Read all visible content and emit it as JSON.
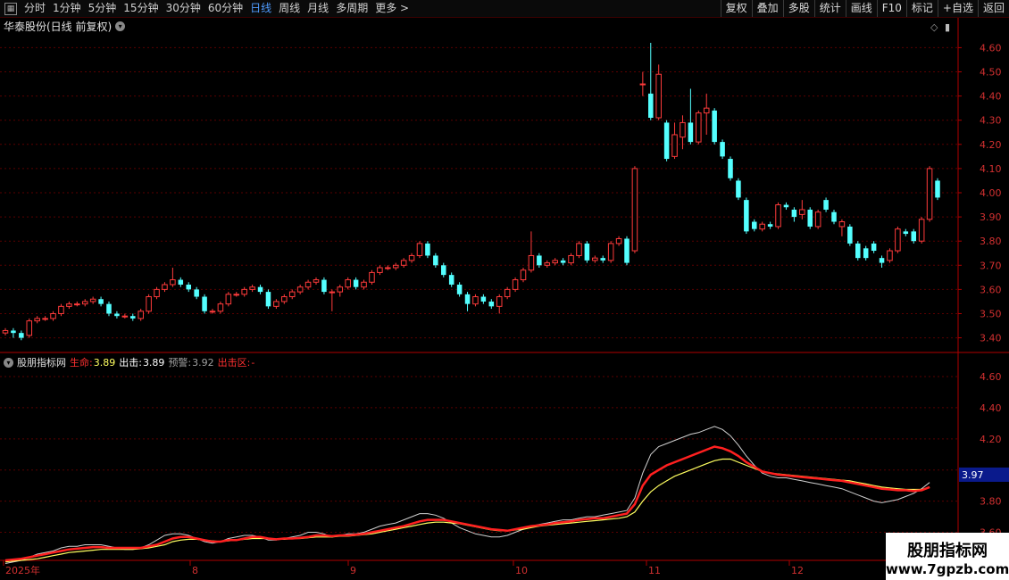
{
  "toolbar": {
    "periods": [
      "分时",
      "1分钟",
      "5分钟",
      "15分钟",
      "30分钟",
      "60分钟",
      "日线",
      "周线",
      "月线",
      "多周期",
      "更多 >"
    ],
    "active_period": "日线",
    "buttons": [
      "复权",
      "叠加",
      "多股",
      "统计",
      "画线",
      "F10",
      "标记",
      "+自选",
      "返回"
    ]
  },
  "stock_title": "华泰股份(日线 前复权)",
  "indicator": {
    "name": "股朋指标网",
    "life_label": "生命:",
    "life_value": "3.89",
    "out_label": "出击:",
    "out_value": "3.89",
    "warn_label": "预警:",
    "warn_value": "3.92",
    "zone_label": "出击区:",
    "zone_value": "-",
    "current_value": "3.97"
  },
  "price_axis": [
    "4.60",
    "4.50",
    "4.40",
    "4.30",
    "4.20",
    "4.10",
    "4.00",
    "3.90",
    "3.80",
    "3.70",
    "3.60",
    "3.50",
    "3.40"
  ],
  "indicator_axis": [
    "4.60",
    "4.40",
    "4.20",
    "3.80",
    "3.60"
  ],
  "date_axis": [
    "2025年",
    "8",
    "9",
    "10",
    "11",
    "12"
  ],
  "watermark": {
    "line1": "股朋指标网",
    "line2": "www.7gpzb.com"
  },
  "colors": {
    "up": "#ff3b3b",
    "down": "#54ffff",
    "grid": "#5a0000",
    "axis": "#b00000",
    "life": "#ff2020",
    "out": "#ffff60",
    "warn": "#d0d0d0"
  },
  "chart_data": {
    "type": "candlestick",
    "ylim": [
      3.36,
      4.66
    ],
    "candles": [
      [
        3.42,
        3.43,
        3.41,
        3.44
      ],
      [
        3.43,
        3.42,
        3.4,
        3.44
      ],
      [
        3.42,
        3.4,
        3.39,
        3.43
      ],
      [
        3.41,
        3.47,
        3.4,
        3.48
      ],
      [
        3.47,
        3.48,
        3.46,
        3.49
      ],
      [
        3.48,
        3.48,
        3.47,
        3.49
      ],
      [
        3.48,
        3.5,
        3.47,
        3.51
      ],
      [
        3.5,
        3.53,
        3.49,
        3.54
      ],
      [
        3.53,
        3.54,
        3.52,
        3.55
      ],
      [
        3.54,
        3.54,
        3.53,
        3.55
      ],
      [
        3.54,
        3.55,
        3.53,
        3.56
      ],
      [
        3.55,
        3.56,
        3.54,
        3.57
      ],
      [
        3.56,
        3.54,
        3.53,
        3.57
      ],
      [
        3.54,
        3.5,
        3.49,
        3.55
      ],
      [
        3.5,
        3.49,
        3.48,
        3.51
      ],
      [
        3.49,
        3.49,
        3.48,
        3.5
      ],
      [
        3.49,
        3.48,
        3.47,
        3.5
      ],
      [
        3.48,
        3.51,
        3.47,
        3.52
      ],
      [
        3.51,
        3.57,
        3.5,
        3.58
      ],
      [
        3.57,
        3.6,
        3.56,
        3.61
      ],
      [
        3.6,
        3.62,
        3.59,
        3.63
      ],
      [
        3.62,
        3.64,
        3.61,
        3.69
      ],
      [
        3.64,
        3.62,
        3.61,
        3.65
      ],
      [
        3.62,
        3.6,
        3.59,
        3.63
      ],
      [
        3.6,
        3.57,
        3.56,
        3.61
      ],
      [
        3.57,
        3.51,
        3.5,
        3.58
      ],
      [
        3.51,
        3.51,
        3.5,
        3.52
      ],
      [
        3.51,
        3.54,
        3.5,
        3.55
      ],
      [
        3.54,
        3.58,
        3.53,
        3.59
      ],
      [
        3.58,
        3.58,
        3.57,
        3.59
      ],
      [
        3.58,
        3.6,
        3.57,
        3.61
      ],
      [
        3.6,
        3.61,
        3.59,
        3.62
      ],
      [
        3.61,
        3.59,
        3.58,
        3.62
      ],
      [
        3.59,
        3.53,
        3.52,
        3.6
      ],
      [
        3.53,
        3.55,
        3.52,
        3.56
      ],
      [
        3.55,
        3.57,
        3.54,
        3.58
      ],
      [
        3.57,
        3.59,
        3.56,
        3.6
      ],
      [
        3.59,
        3.61,
        3.58,
        3.62
      ],
      [
        3.61,
        3.63,
        3.6,
        3.64
      ],
      [
        3.63,
        3.64,
        3.62,
        3.65
      ],
      [
        3.64,
        3.59,
        3.58,
        3.65
      ],
      [
        3.59,
        3.59,
        3.51,
        3.6
      ],
      [
        3.59,
        3.61,
        3.57,
        3.62
      ],
      [
        3.61,
        3.64,
        3.6,
        3.65
      ],
      [
        3.64,
        3.61,
        3.6,
        3.65
      ],
      [
        3.61,
        3.63,
        3.6,
        3.64
      ],
      [
        3.63,
        3.67,
        3.62,
        3.68
      ],
      [
        3.67,
        3.69,
        3.66,
        3.7
      ],
      [
        3.69,
        3.69,
        3.68,
        3.7
      ],
      [
        3.69,
        3.7,
        3.68,
        3.71
      ],
      [
        3.7,
        3.72,
        3.69,
        3.73
      ],
      [
        3.72,
        3.74,
        3.71,
        3.75
      ],
      [
        3.74,
        3.79,
        3.73,
        3.8
      ],
      [
        3.79,
        3.74,
        3.73,
        3.8
      ],
      [
        3.74,
        3.7,
        3.69,
        3.75
      ],
      [
        3.7,
        3.66,
        3.65,
        3.71
      ],
      [
        3.66,
        3.62,
        3.61,
        3.67
      ],
      [
        3.62,
        3.58,
        3.57,
        3.63
      ],
      [
        3.58,
        3.54,
        3.51,
        3.59
      ],
      [
        3.54,
        3.57,
        3.53,
        3.58
      ],
      [
        3.57,
        3.55,
        3.54,
        3.58
      ],
      [
        3.55,
        3.53,
        3.52,
        3.56
      ],
      [
        3.53,
        3.57,
        3.5,
        3.58
      ],
      [
        3.57,
        3.6,
        3.56,
        3.61
      ],
      [
        3.6,
        3.64,
        3.59,
        3.65
      ],
      [
        3.64,
        3.68,
        3.63,
        3.69
      ],
      [
        3.68,
        3.74,
        3.67,
        3.84
      ],
      [
        3.74,
        3.7,
        3.69,
        3.75
      ],
      [
        3.7,
        3.71,
        3.69,
        3.72
      ],
      [
        3.71,
        3.72,
        3.7,
        3.73
      ],
      [
        3.72,
        3.71,
        3.7,
        3.73
      ],
      [
        3.71,
        3.74,
        3.7,
        3.75
      ],
      [
        3.74,
        3.79,
        3.73,
        3.8
      ],
      [
        3.79,
        3.72,
        3.71,
        3.8
      ],
      [
        3.72,
        3.73,
        3.71,
        3.74
      ],
      [
        3.73,
        3.72,
        3.71,
        3.74
      ],
      [
        3.72,
        3.79,
        3.71,
        3.8
      ],
      [
        3.79,
        3.81,
        3.78,
        3.82
      ],
      [
        3.81,
        3.71,
        3.7,
        3.82
      ],
      [
        3.76,
        4.1,
        3.75,
        4.11
      ],
      [
        4.45,
        4.45,
        4.4,
        4.5
      ],
      [
        4.41,
        4.31,
        4.3,
        4.62
      ],
      [
        4.31,
        4.49,
        4.3,
        4.53
      ],
      [
        4.29,
        4.14,
        4.13,
        4.3
      ],
      [
        4.15,
        4.24,
        4.14,
        4.29
      ],
      [
        4.23,
        4.29,
        4.18,
        4.32
      ],
      [
        4.29,
        4.21,
        4.2,
        4.43
      ],
      [
        4.21,
        4.33,
        4.2,
        4.34
      ],
      [
        4.33,
        4.35,
        4.24,
        4.41
      ],
      [
        4.34,
        4.21,
        4.2,
        4.35
      ],
      [
        4.21,
        4.15,
        4.14,
        4.22
      ],
      [
        4.14,
        4.06,
        4.05,
        4.15
      ],
      [
        4.05,
        3.98,
        3.97,
        4.06
      ],
      [
        3.97,
        3.84,
        3.83,
        3.98
      ],
      [
        3.88,
        3.85,
        3.84,
        3.89
      ],
      [
        3.85,
        3.87,
        3.84,
        3.88
      ],
      [
        3.87,
        3.86,
        3.85,
        3.88
      ],
      [
        3.86,
        3.95,
        3.85,
        3.96
      ],
      [
        3.95,
        3.94,
        3.93,
        3.96
      ],
      [
        3.93,
        3.9,
        3.88,
        3.94
      ],
      [
        3.91,
        3.93,
        3.89,
        3.97
      ],
      [
        3.93,
        3.86,
        3.85,
        3.94
      ],
      [
        3.86,
        3.92,
        3.85,
        3.93
      ],
      [
        3.97,
        3.93,
        3.92,
        3.98
      ],
      [
        3.92,
        3.88,
        3.87,
        3.93
      ],
      [
        3.86,
        3.88,
        3.82,
        3.89
      ],
      [
        3.86,
        3.79,
        3.78,
        3.87
      ],
      [
        3.79,
        3.73,
        3.72,
        3.8
      ],
      [
        3.77,
        3.73,
        3.72,
        3.78
      ],
      [
        3.79,
        3.76,
        3.75,
        3.8
      ],
      [
        3.73,
        3.71,
        3.69,
        3.74
      ],
      [
        3.72,
        3.76,
        3.71,
        3.77
      ],
      [
        3.76,
        3.85,
        3.75,
        3.86
      ],
      [
        3.84,
        3.83,
        3.82,
        3.85
      ],
      [
        3.84,
        3.8,
        3.79,
        3.85
      ],
      [
        3.8,
        3.89,
        3.79,
        3.9
      ],
      [
        3.89,
        4.1,
        3.88,
        4.11
      ],
      [
        4.05,
        3.98,
        3.97,
        4.06
      ]
    ],
    "life": [
      3.42,
      3.425,
      3.43,
      3.44,
      3.45,
      3.46,
      3.47,
      3.48,
      3.49,
      3.495,
      3.5,
      3.505,
      3.505,
      3.5,
      3.5,
      3.5,
      3.5,
      3.5,
      3.51,
      3.52,
      3.54,
      3.56,
      3.57,
      3.57,
      3.56,
      3.55,
      3.54,
      3.54,
      3.55,
      3.55,
      3.56,
      3.57,
      3.57,
      3.56,
      3.555,
      3.56,
      3.56,
      3.565,
      3.57,
      3.58,
      3.58,
      3.575,
      3.58,
      3.58,
      3.585,
      3.59,
      3.6,
      3.61,
      3.62,
      3.63,
      3.64,
      3.655,
      3.67,
      3.68,
      3.68,
      3.68,
      3.67,
      3.66,
      3.65,
      3.64,
      3.63,
      3.62,
      3.615,
      3.61,
      3.62,
      3.63,
      3.64,
      3.645,
      3.65,
      3.66,
      3.665,
      3.67,
      3.68,
      3.685,
      3.69,
      3.69,
      3.7,
      3.71,
      3.72,
      3.78,
      3.9,
      3.97,
      4.0,
      4.03,
      4.05,
      4.07,
      4.09,
      4.11,
      4.13,
      4.15,
      4.14,
      4.12,
      4.09,
      4.05,
      4.02,
      3.99,
      3.98,
      3.97,
      3.965,
      3.96,
      3.955,
      3.95,
      3.945,
      3.94,
      3.935,
      3.93,
      3.92,
      3.91,
      3.9,
      3.89,
      3.88,
      3.875,
      3.87,
      3.87,
      3.865,
      3.87,
      3.89
    ],
    "out": [
      3.41,
      3.415,
      3.42,
      3.425,
      3.43,
      3.44,
      3.45,
      3.46,
      3.47,
      3.475,
      3.48,
      3.485,
      3.49,
      3.49,
      3.49,
      3.49,
      3.49,
      3.495,
      3.5,
      3.51,
      3.52,
      3.54,
      3.55,
      3.555,
      3.555,
      3.55,
      3.545,
      3.54,
      3.545,
      3.55,
      3.555,
      3.56,
      3.56,
      3.56,
      3.555,
      3.555,
      3.56,
      3.56,
      3.565,
      3.57,
      3.57,
      3.57,
      3.575,
      3.575,
      3.58,
      3.585,
      3.59,
      3.6,
      3.61,
      3.62,
      3.63,
      3.64,
      3.65,
      3.66,
      3.665,
      3.665,
      3.66,
      3.655,
      3.645,
      3.635,
      3.625,
      3.615,
      3.61,
      3.61,
      3.615,
      3.62,
      3.63,
      3.64,
      3.645,
      3.65,
      3.655,
      3.66,
      3.665,
      3.67,
      3.675,
      3.68,
      3.685,
      3.69,
      3.7,
      3.73,
      3.8,
      3.86,
      3.9,
      3.93,
      3.96,
      3.98,
      4.0,
      4.02,
      4.04,
      4.06,
      4.07,
      4.07,
      4.05,
      4.03,
      4.01,
      3.99,
      3.98,
      3.975,
      3.97,
      3.965,
      3.96,
      3.955,
      3.95,
      3.945,
      3.94,
      3.935,
      3.93,
      3.92,
      3.91,
      3.9,
      3.89,
      3.885,
      3.88,
      3.875,
      3.875,
      3.875,
      3.89
    ],
    "warn": [
      3.4,
      3.41,
      3.42,
      3.44,
      3.46,
      3.47,
      3.48,
      3.5,
      3.51,
      3.51,
      3.52,
      3.52,
      3.52,
      3.51,
      3.5,
      3.49,
      3.49,
      3.5,
      3.52,
      3.55,
      3.58,
      3.59,
      3.59,
      3.58,
      3.56,
      3.54,
      3.53,
      3.54,
      3.56,
      3.57,
      3.58,
      3.58,
      3.57,
      3.55,
      3.55,
      3.56,
      3.57,
      3.58,
      3.6,
      3.6,
      3.59,
      3.57,
      3.58,
      3.59,
      3.59,
      3.6,
      3.62,
      3.64,
      3.65,
      3.66,
      3.68,
      3.7,
      3.72,
      3.72,
      3.71,
      3.69,
      3.66,
      3.63,
      3.61,
      3.59,
      3.58,
      3.57,
      3.57,
      3.58,
      3.6,
      3.62,
      3.64,
      3.65,
      3.66,
      3.67,
      3.68,
      3.68,
      3.69,
      3.7,
      3.7,
      3.71,
      3.72,
      3.73,
      3.74,
      3.82,
      3.98,
      4.1,
      4.15,
      4.17,
      4.19,
      4.21,
      4.23,
      4.24,
      4.26,
      4.28,
      4.26,
      4.22,
      4.16,
      4.09,
      4.03,
      3.98,
      3.96,
      3.95,
      3.95,
      3.94,
      3.93,
      3.92,
      3.91,
      3.9,
      3.89,
      3.88,
      3.86,
      3.84,
      3.82,
      3.8,
      3.79,
      3.8,
      3.81,
      3.83,
      3.85,
      3.88,
      3.92
    ]
  }
}
